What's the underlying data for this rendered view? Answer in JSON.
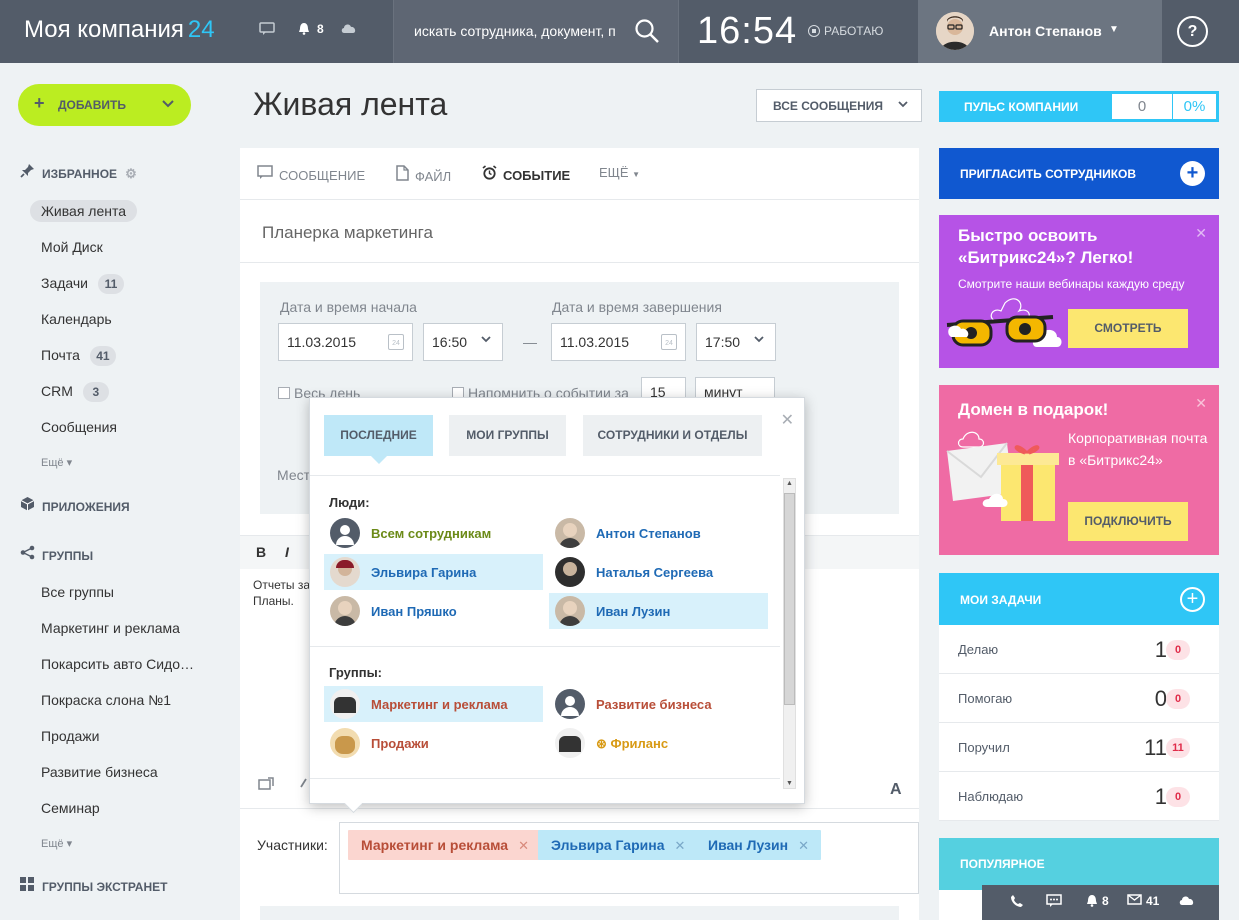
{
  "header": {
    "logo_text": "Моя компания",
    "logo_num": "24",
    "notifications": "8",
    "search_placeholder": "искать сотрудника, документ, п",
    "clock": "16:54",
    "work_status": "РАБОТАЮ",
    "user_name": "Антон Степанов",
    "help": "?"
  },
  "sidebar": {
    "add_label": "ДОБАВИТЬ",
    "favorites_title": "ИЗБРАННОЕ",
    "favorites": [
      {
        "label": "Живая лента"
      },
      {
        "label": "Мой Диск"
      },
      {
        "label": "Задачи",
        "count": "11"
      },
      {
        "label": "Календарь"
      },
      {
        "label": "Почта",
        "count": "41"
      },
      {
        "label": "CRM",
        "count": "3"
      },
      {
        "label": "Сообщения"
      }
    ],
    "more": "Ещё",
    "apps_title": "ПРИЛОЖЕНИЯ",
    "groups_title": "ГРУППЫ",
    "groups": [
      "Все группы",
      "Маркетинг и реклама",
      "Покарсить авто Сидо…",
      "Покраска слона №1",
      "Продажи",
      "Развитие бизнеса",
      "Семинар"
    ],
    "extranet_title": "ГРУППЫ ЭКСТРАНЕТ"
  },
  "main": {
    "title": "Живая лента",
    "filter": "ВСЕ СООБЩЕНИЯ",
    "tabs": [
      "СООБЩЕНИЕ",
      "ФАЙЛ",
      "СОБЫТИЕ",
      "ЕЩЁ"
    ],
    "event_title": "Планерка маркетинга",
    "start_label": "Дата и время начала",
    "end_label": "Дата и время завершения",
    "start_date": "11.03.2015",
    "start_time": "16:50",
    "end_date": "11.03.2015",
    "end_time": "17:50",
    "dash": "—",
    "allday": "Весь день",
    "remind": "Напомнить о событии за",
    "remind_num": "15",
    "remind_unit": "минут",
    "place": "Мест",
    "editor_text_1": "Отчеты за",
    "editor_text_2": "Планы.",
    "participants_label": "Участники:",
    "chips": [
      {
        "label": "Маркетинг и реклама",
        "type": "grp"
      },
      {
        "label": "Эльвира Гарина",
        "type": "usr"
      },
      {
        "label": "Иван Лузин",
        "type": "usr"
      }
    ]
  },
  "popup": {
    "tabs": [
      "ПОСЛЕДНИЕ",
      "МОИ ГРУППЫ",
      "СОТРУДНИКИ И ОТДЕЛЫ"
    ],
    "people_title": "Люди:",
    "people": [
      {
        "name": "Всем сотрудникам",
        "color": "green"
      },
      {
        "name": "Антон Степанов",
        "color": "blue"
      },
      {
        "name": "Эльвира Гарина",
        "color": "blue",
        "selected": true
      },
      {
        "name": "Наталья Сергеева",
        "color": "blue"
      },
      {
        "name": "Иван Пряшко",
        "color": "blue"
      },
      {
        "name": "Иван Лузин",
        "color": "blue",
        "selected": true
      }
    ],
    "groups_title": "Группы:",
    "groups": [
      {
        "name": "Маркетинг и реклама",
        "color": "red",
        "selected": true
      },
      {
        "name": "Развитие бизнеса",
        "color": "red"
      },
      {
        "name": "Продажи",
        "color": "red"
      },
      {
        "name": "Фриланс",
        "color": "orange"
      }
    ]
  },
  "right": {
    "pulse_label": "ПУЛЬС КОМПАНИИ",
    "pulse_value": "0",
    "pulse_percent": "0%",
    "invite_label": "ПРИГЛАСИТЬ СОТРУДНИКОВ",
    "promo1_title": "Быстро освоить «Битрикс24»? Легко!",
    "promo1_sub": "Смотрите наши вебинары каждую среду",
    "promo1_btn": "СМОТРЕТЬ",
    "promo2_title": "Домен в подарок!",
    "promo2_sub": "Корпоративная почта в «Битрикс24»",
    "promo2_btn": "ПОДКЛЮЧИТЬ",
    "tasks_title": "МОИ ЗАДАЧИ",
    "tasks": [
      {
        "name": "Делаю",
        "value": "1",
        "badge": "0"
      },
      {
        "name": "Помогаю",
        "value": "0",
        "badge": "0"
      },
      {
        "name": "Поручил",
        "value": "11",
        "badge": "11"
      },
      {
        "name": "Наблюдаю",
        "value": "1",
        "badge": "0"
      }
    ],
    "popular_title": "ПОПУЛЯРНОЕ"
  },
  "dock": {
    "notifications": "8",
    "mail": "41"
  },
  "colors": {
    "header": "#535c69",
    "accent": "#2fc6f6",
    "add": "#bbed21",
    "invite": "#1058d0",
    "promo1": "#b653e6",
    "promo2": "#ef6ba4"
  }
}
